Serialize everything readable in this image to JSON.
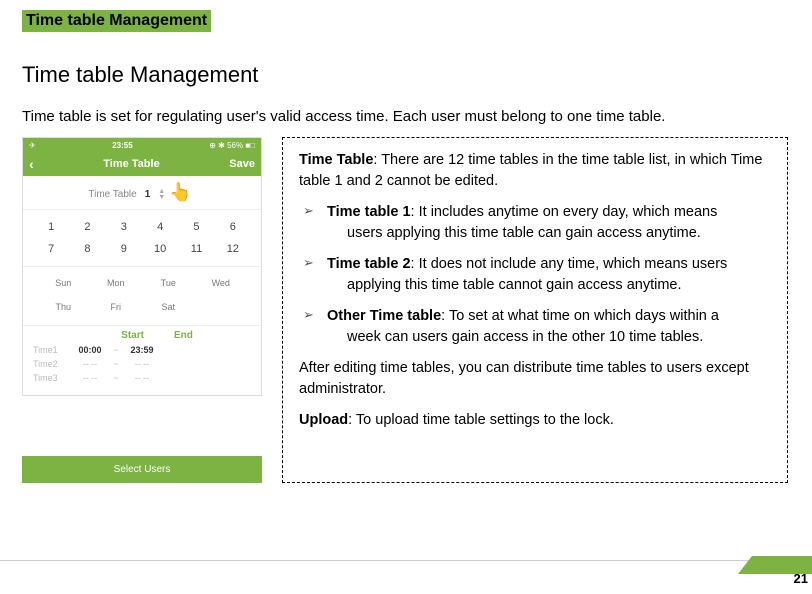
{
  "highlight": "Time table Management",
  "heading": "Time table Management",
  "intro": "Time table is set for regulating user's valid access time. Each user must belong to one time table.",
  "phone": {
    "status_time": "23:55",
    "status_right": "⊕ ✱ 56% ■□",
    "back": "‹",
    "nav_title": "Time Table",
    "save": "Save",
    "tt_label": "Time Table",
    "tt_value": "1",
    "hand": "👆",
    "numbers": [
      "1",
      "2",
      "3",
      "4",
      "5",
      "6",
      "7",
      "8",
      "9",
      "10",
      "11",
      "12"
    ],
    "days_r1": [
      "Sun",
      "Mon",
      "Tue",
      "Wed"
    ],
    "days_r2": [
      "Thu",
      "Fri",
      "Sat",
      ""
    ],
    "th_start": "Start",
    "th_end": "End",
    "times": [
      {
        "label": "Time1",
        "start": "00:00",
        "end": "23:59",
        "dim": false
      },
      {
        "label": "Time2",
        "start": "-- --",
        "end": "-- --",
        "dim": true
      },
      {
        "label": "Time3",
        "start": "-- --",
        "end": "-- --",
        "dim": true
      }
    ],
    "select_users": "Select Users"
  },
  "info": {
    "p1a": "Time Table",
    "p1b": ": There are 12 time tables in the time table list, in which Time table 1 and 2 cannot be edited.",
    "b1h": "Time table 1",
    "b1a": ": It includes anytime on every day, which means",
    "b1b": "users applying this time table can gain access anytime.",
    "b2h": "Time table 2",
    "b2a": ": It does not include any time, which means users",
    "b2b": "applying this time table cannot gain access anytime.",
    "b3h": "Other Time table",
    "b3a": ": To set at what time on which days within a",
    "b3b": "week can users gain access in the other 10 time tables.",
    "p2": "After editing time tables, you can distribute time tables to users except administrator.",
    "p3a": "Upload",
    "p3b": ": To upload time table settings to the lock.",
    "marker": "➢"
  },
  "page": "21"
}
